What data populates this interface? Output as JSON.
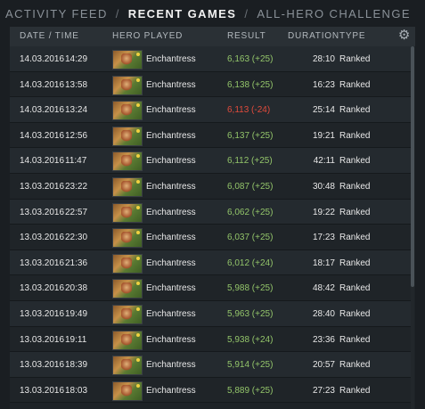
{
  "tabs": [
    {
      "label": "Activity Feed"
    },
    {
      "label": "Recent Games"
    },
    {
      "label": "All-Hero Challenge"
    }
  ],
  "tab_separator": "/",
  "header": {
    "date_time": "Date / Time",
    "hero_played": "Hero Played",
    "result": "Result",
    "duration": "Duration",
    "type": "Type"
  },
  "settings_icon": "gear-icon",
  "colors": {
    "win": "#93c56a",
    "loss": "#e24b3c"
  },
  "rows": [
    {
      "date": "14.03.2016",
      "time": "14:29",
      "hero": "Enchantress",
      "result": "6,163 (+25)",
      "outcome": "pos",
      "duration": "28:10",
      "type": "Ranked"
    },
    {
      "date": "14.03.2016",
      "time": "13:58",
      "hero": "Enchantress",
      "result": "6,138 (+25)",
      "outcome": "pos",
      "duration": "16:23",
      "type": "Ranked"
    },
    {
      "date": "14.03.2016",
      "time": "13:24",
      "hero": "Enchantress",
      "result": "6,113 (-24)",
      "outcome": "neg",
      "duration": "25:14",
      "type": "Ranked"
    },
    {
      "date": "14.03.2016",
      "time": "12:56",
      "hero": "Enchantress",
      "result": "6,137 (+25)",
      "outcome": "pos",
      "duration": "19:21",
      "type": "Ranked"
    },
    {
      "date": "14.03.2016",
      "time": "11:47",
      "hero": "Enchantress",
      "result": "6,112 (+25)",
      "outcome": "pos",
      "duration": "42:11",
      "type": "Ranked"
    },
    {
      "date": "13.03.2016",
      "time": "23:22",
      "hero": "Enchantress",
      "result": "6,087 (+25)",
      "outcome": "pos",
      "duration": "30:48",
      "type": "Ranked"
    },
    {
      "date": "13.03.2016",
      "time": "22:57",
      "hero": "Enchantress",
      "result": "6,062 (+25)",
      "outcome": "pos",
      "duration": "19:22",
      "type": "Ranked"
    },
    {
      "date": "13.03.2016",
      "time": "22:30",
      "hero": "Enchantress",
      "result": "6,037 (+25)",
      "outcome": "pos",
      "duration": "17:23",
      "type": "Ranked"
    },
    {
      "date": "13.03.2016",
      "time": "21:36",
      "hero": "Enchantress",
      "result": "6,012 (+24)",
      "outcome": "pos",
      "duration": "18:17",
      "type": "Ranked"
    },
    {
      "date": "13.03.2016",
      "time": "20:38",
      "hero": "Enchantress",
      "result": "5,988 (+25)",
      "outcome": "pos",
      "duration": "48:42",
      "type": "Ranked"
    },
    {
      "date": "13.03.2016",
      "time": "19:49",
      "hero": "Enchantress",
      "result": "5,963 (+25)",
      "outcome": "pos",
      "duration": "28:40",
      "type": "Ranked"
    },
    {
      "date": "13.03.2016",
      "time": "19:11",
      "hero": "Enchantress",
      "result": "5,938 (+24)",
      "outcome": "pos",
      "duration": "23:36",
      "type": "Ranked"
    },
    {
      "date": "13.03.2016",
      "time": "18:39",
      "hero": "Enchantress",
      "result": "5,914 (+25)",
      "outcome": "pos",
      "duration": "20:57",
      "type": "Ranked"
    },
    {
      "date": "13.03.2016",
      "time": "18:03",
      "hero": "Enchantress",
      "result": "5,889 (+25)",
      "outcome": "pos",
      "duration": "27:23",
      "type": "Ranked"
    }
  ]
}
